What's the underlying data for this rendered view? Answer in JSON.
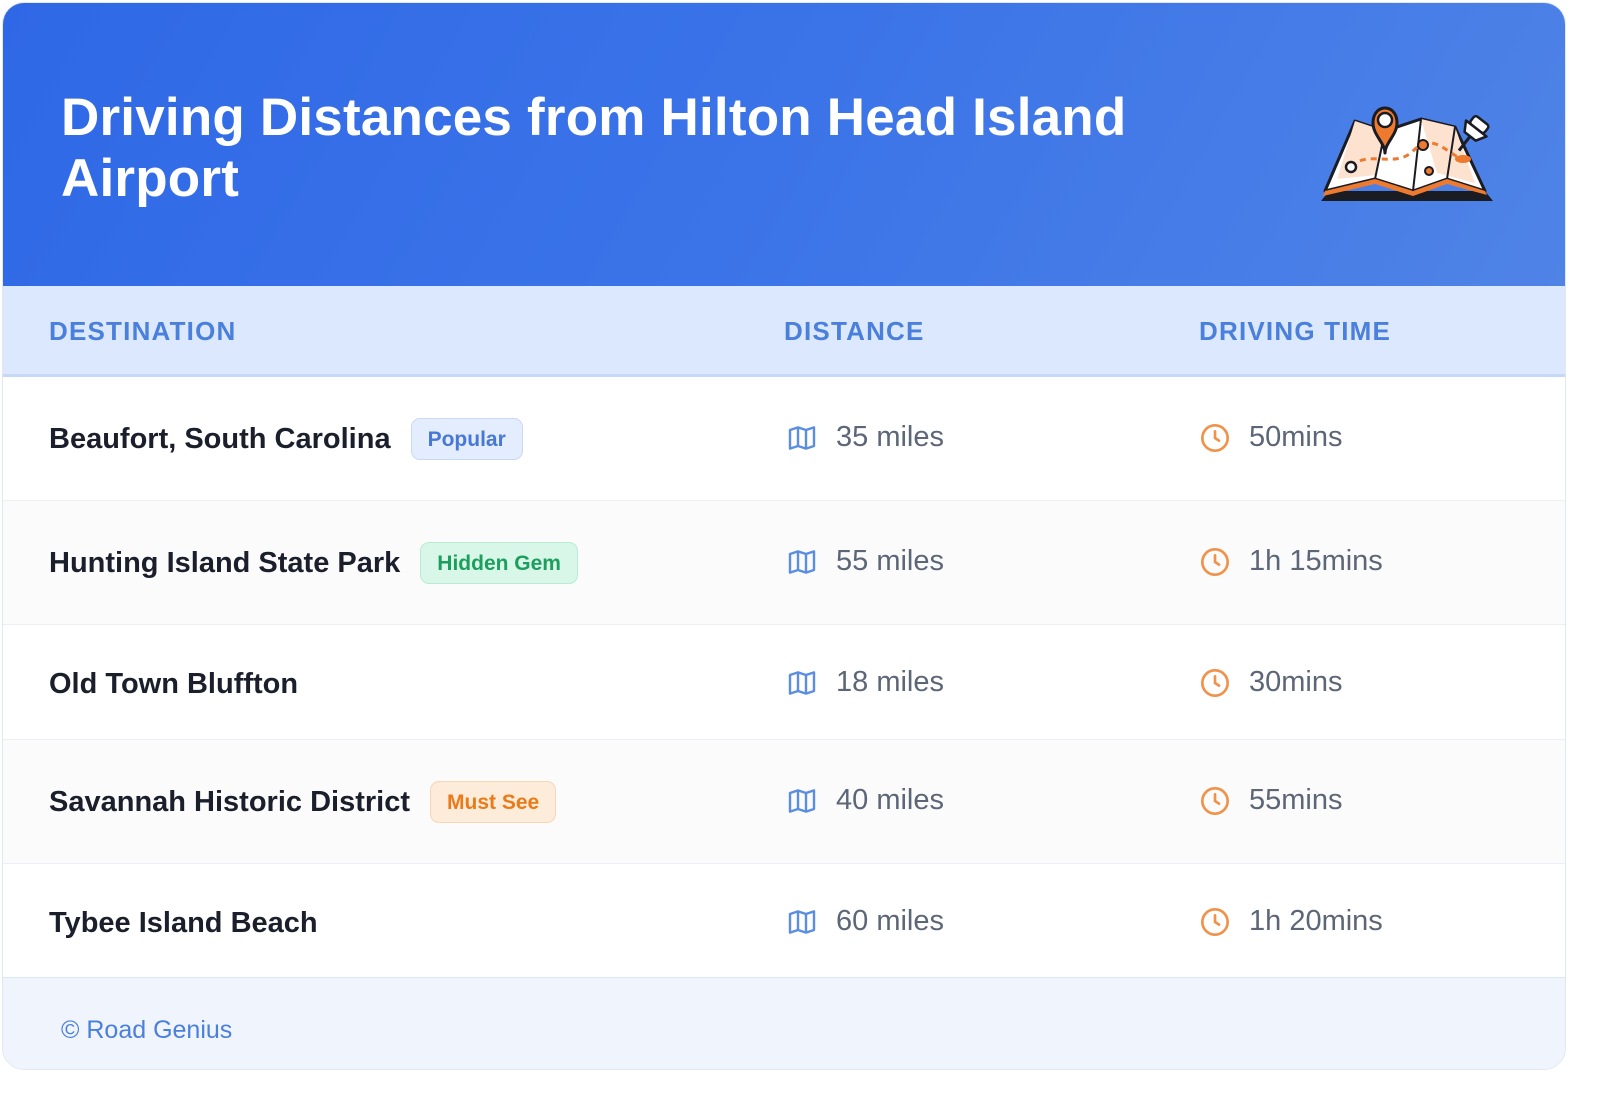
{
  "header": {
    "title": "Driving Distances from Hilton Head Island Airport",
    "icon": "folded-map-with-pins-icon"
  },
  "table": {
    "columns": [
      "DESTINATION",
      "DISTANCE",
      "DRIVING TIME"
    ],
    "rows": [
      {
        "destination": "Beaufort, South Carolina",
        "badge": "Popular",
        "badge_color": "#4878d6",
        "distance": "35 miles",
        "time": "50mins"
      },
      {
        "destination": "Hunting Island State Park",
        "badge": "Hidden Gem",
        "badge_color": "#1c9f5e",
        "distance": "55 miles",
        "time": "1h 15mins"
      },
      {
        "destination": "Old Town Bluffton",
        "badge": "",
        "distance": "18 miles",
        "time": "30mins"
      },
      {
        "destination": "Savannah Historic District",
        "badge": "Must See",
        "badge_color": "#ea7a1a",
        "distance": "40 miles",
        "time": "55mins"
      },
      {
        "destination": "Tybee Island Beach",
        "badge": "",
        "distance": "60 miles",
        "time": "1h 20mins"
      }
    ]
  },
  "footer": {
    "text": "© Road Genius"
  },
  "colors": {
    "header_gradient_start": "#2f68e6",
    "header_gradient_end": "#4f83e6",
    "accent_blue": "#4a7fdc",
    "clock_orange": "#f0924a"
  }
}
